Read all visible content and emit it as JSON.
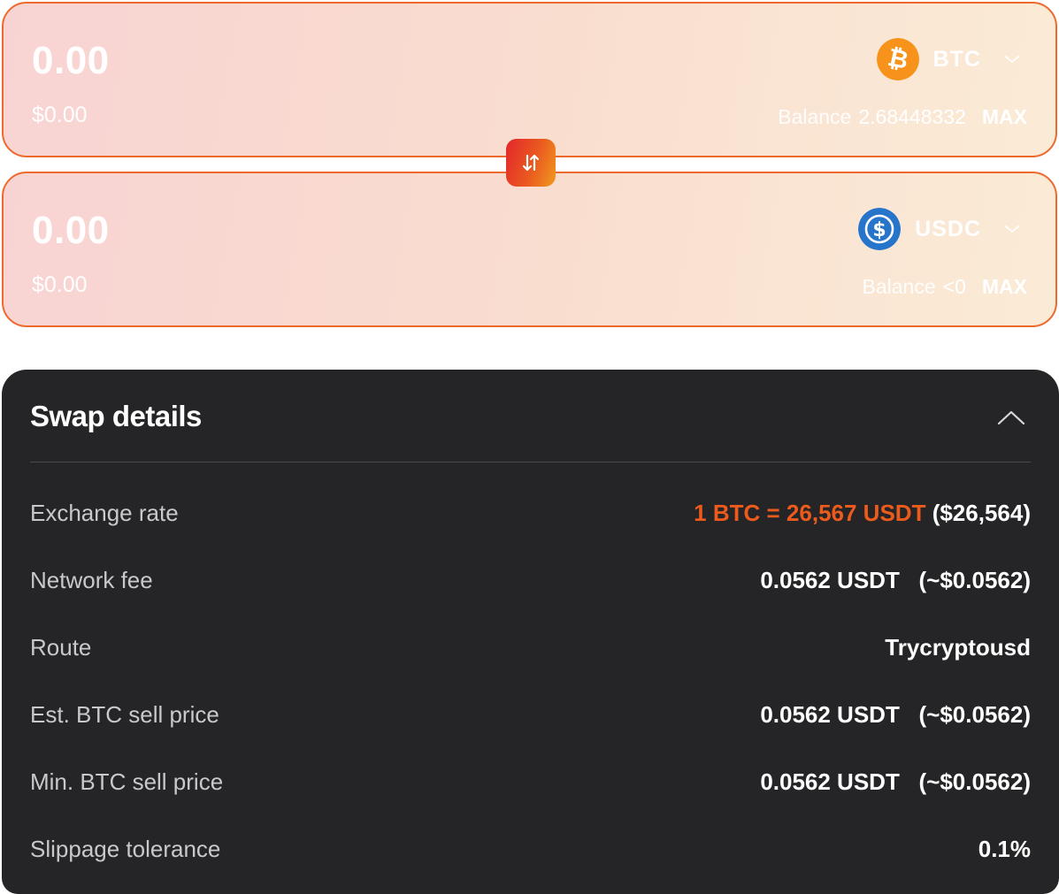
{
  "from": {
    "amount": "0.00",
    "fiat": "$0.00",
    "token": {
      "symbol": "BTC",
      "icon": "bitcoin-icon",
      "color": "#f7931a"
    },
    "balance_label": "Balance",
    "balance_value": "2.68448332",
    "max_label": "MAX"
  },
  "to": {
    "amount": "0.00",
    "fiat": "$0.00",
    "token": {
      "symbol": "USDC",
      "icon": "usdc-icon",
      "color": "#2775ca"
    },
    "balance_label": "Balance",
    "balance_value": "<0",
    "max_label": "MAX"
  },
  "switch": {
    "icon": "swap-arrows-icon"
  },
  "details": {
    "title": "Swap details",
    "rows": [
      {
        "label": "Exchange rate",
        "value_highlight": "1 BTC = 26,567 USDT",
        "value": "($26,564)"
      },
      {
        "label": "Network fee",
        "value": "0.0562 USDT   (~$0.0562)"
      },
      {
        "label": "Route",
        "value": "Trycryptousd"
      },
      {
        "label": "Est. BTC sell price",
        "value": "0.0562 USDT   (~$0.0562)"
      },
      {
        "label": "Min. BTC sell price",
        "value": "0.0562 USDT   (~$0.0562)"
      },
      {
        "label": "Slippage tolerance",
        "value": "0.1%"
      }
    ]
  },
  "colors": {
    "accent": "#ec5a1c",
    "card_border": "#ee6a2c",
    "panel_bg": "#252527"
  }
}
